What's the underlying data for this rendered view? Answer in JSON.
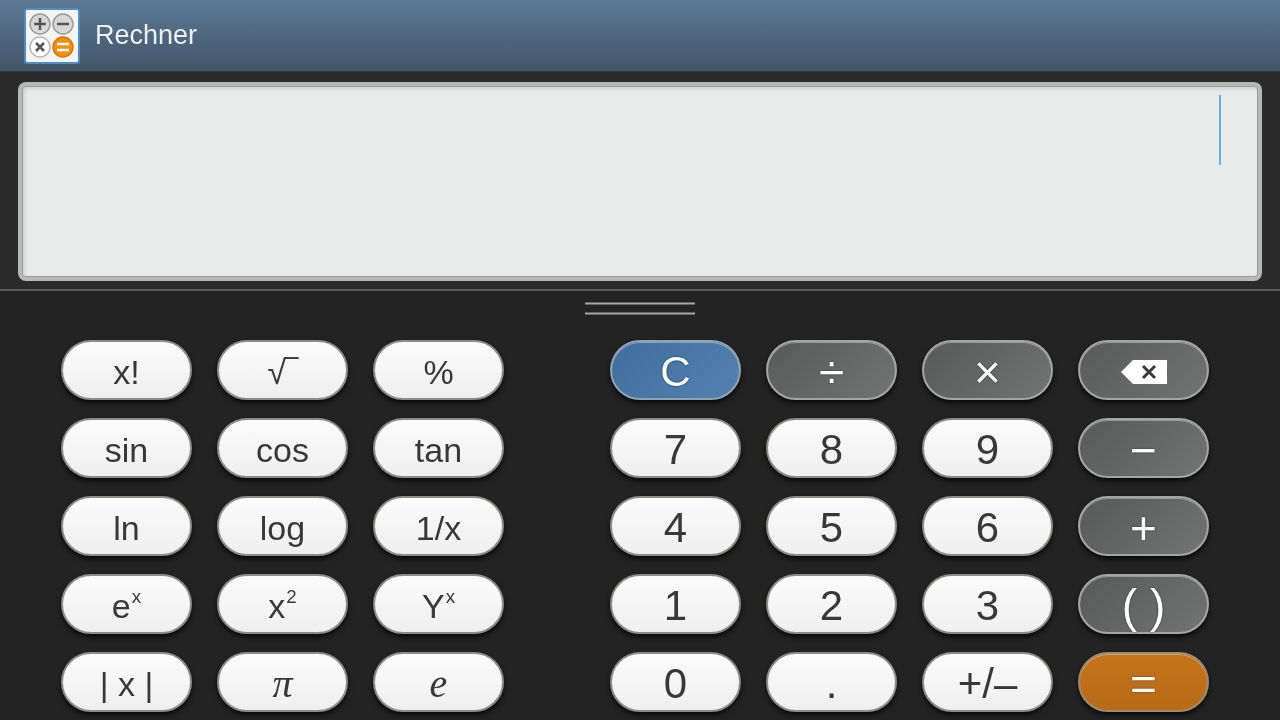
{
  "window": {
    "title": "Rechner"
  },
  "display": {
    "cursor": true
  },
  "scientific_keys": [
    {
      "kind": "function",
      "label": "x!"
    },
    {
      "kind": "function",
      "label": "√‾"
    },
    {
      "kind": "function",
      "label": "%"
    },
    {
      "kind": "function",
      "label": "sin"
    },
    {
      "kind": "function",
      "label": "cos"
    },
    {
      "kind": "function",
      "label": "tan"
    },
    {
      "kind": "function",
      "label": "ln"
    },
    {
      "kind": "function",
      "label": "log"
    },
    {
      "kind": "function",
      "label": "1/x"
    },
    {
      "kind": "function",
      "label": "e$^{x}$"
    },
    {
      "kind": "function",
      "label": "x$^{2}$"
    },
    {
      "kind": "function",
      "label": "Y$^{x}$"
    },
    {
      "kind": "function",
      "label": "| x |"
    },
    {
      "kind": "constant",
      "label": "π"
    },
    {
      "kind": "constant",
      "label": "e"
    }
  ],
  "keypad": [
    {
      "kind": "clear",
      "label": "C"
    },
    {
      "kind": "operator",
      "label": "÷"
    },
    {
      "kind": "operator",
      "label": "×"
    },
    {
      "kind": "backspace"
    },
    {
      "kind": "digit",
      "label": "7"
    },
    {
      "kind": "digit",
      "label": "8"
    },
    {
      "kind": "digit",
      "label": "9"
    },
    {
      "kind": "operator",
      "label": "−"
    },
    {
      "kind": "digit",
      "label": "4"
    },
    {
      "kind": "digit",
      "label": "5"
    },
    {
      "kind": "digit",
      "label": "6"
    },
    {
      "kind": "operator",
      "label": "+"
    },
    {
      "kind": "digit",
      "label": "1"
    },
    {
      "kind": "digit",
      "label": "2"
    },
    {
      "kind": "digit",
      "label": "3"
    },
    {
      "kind": "operator",
      "label": "( )"
    },
    {
      "kind": "digit",
      "label": "0"
    },
    {
      "kind": "digit",
      "label": "."
    },
    {
      "kind": "digit",
      "label": "+/–"
    },
    {
      "kind": "equals",
      "label": "="
    }
  ]
}
